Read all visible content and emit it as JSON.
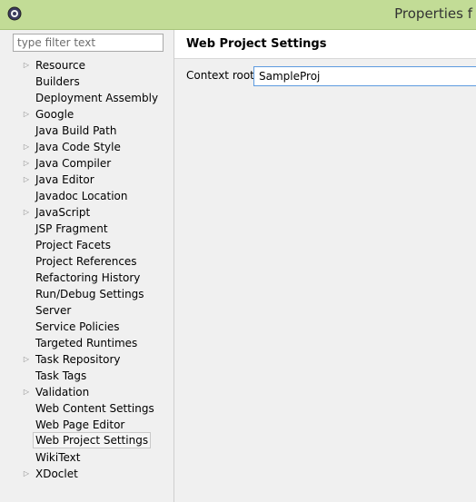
{
  "window": {
    "title": "Properties f"
  },
  "filter": {
    "placeholder": "type filter text",
    "value": ""
  },
  "tree": [
    {
      "label": "Resource",
      "expandable": true
    },
    {
      "label": "Builders",
      "expandable": false
    },
    {
      "label": "Deployment Assembly",
      "expandable": false
    },
    {
      "label": "Google",
      "expandable": true
    },
    {
      "label": "Java Build Path",
      "expandable": false
    },
    {
      "label": "Java Code Style",
      "expandable": true
    },
    {
      "label": "Java Compiler",
      "expandable": true
    },
    {
      "label": "Java Editor",
      "expandable": true
    },
    {
      "label": "Javadoc Location",
      "expandable": false
    },
    {
      "label": "JavaScript",
      "expandable": true
    },
    {
      "label": "JSP Fragment",
      "expandable": false
    },
    {
      "label": "Project Facets",
      "expandable": false
    },
    {
      "label": "Project References",
      "expandable": false
    },
    {
      "label": "Refactoring History",
      "expandable": false
    },
    {
      "label": "Run/Debug Settings",
      "expandable": false
    },
    {
      "label": "Server",
      "expandable": false
    },
    {
      "label": "Service Policies",
      "expandable": false
    },
    {
      "label": "Targeted Runtimes",
      "expandable": false
    },
    {
      "label": "Task Repository",
      "expandable": true
    },
    {
      "label": "Task Tags",
      "expandable": false
    },
    {
      "label": "Validation",
      "expandable": true
    },
    {
      "label": "Web Content Settings",
      "expandable": false
    },
    {
      "label": "Web Page Editor",
      "expandable": false
    },
    {
      "label": "Web Project Settings",
      "expandable": false,
      "selected": true
    },
    {
      "label": "WikiText",
      "expandable": false
    },
    {
      "label": "XDoclet",
      "expandable": true
    }
  ],
  "page": {
    "title": "Web Project Settings",
    "context_root_label": "Context root:",
    "context_root_value": "SampleProj"
  },
  "colors": {
    "titlebar": "#c2dc96",
    "input_focus_border": "#5d9be0"
  }
}
